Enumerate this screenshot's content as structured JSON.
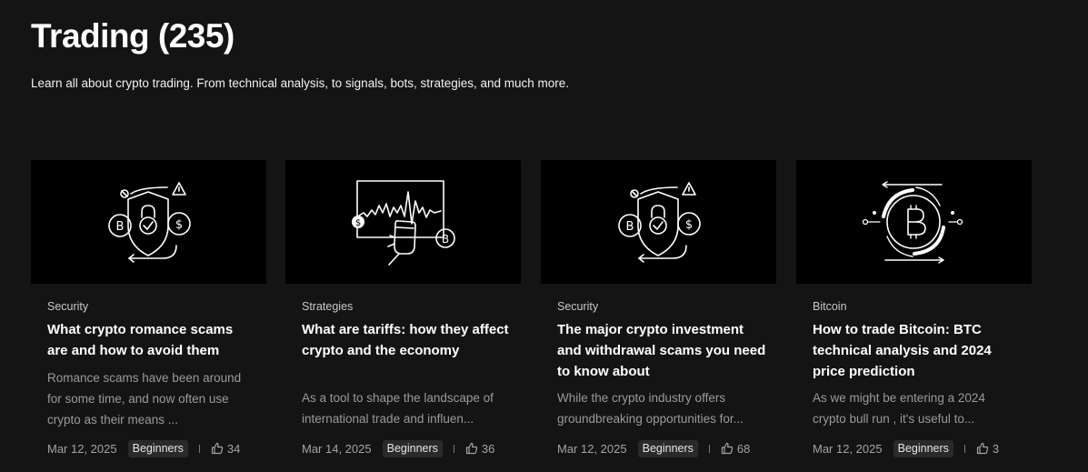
{
  "header": {
    "title": "Trading (235)",
    "subtitle": "Learn all about crypto trading. From technical analysis, to signals, bots, strategies, and much more."
  },
  "cards": [
    {
      "category": "Security",
      "title": "What crypto romance scams are and how to avoid them",
      "excerpt": "Romance scams have been around for some time, and now often use crypto as their means ...",
      "date": "Mar 12, 2025",
      "tag": "Beginners",
      "likes": "34",
      "image_icon": "shield-scam-icon"
    },
    {
      "category": "Strategies",
      "title": "What are tariffs: how they affect crypto and the economy",
      "excerpt": "As a tool to shape the landscape of international trade and influen...",
      "date": "Mar 14, 2025",
      "tag": "Beginners",
      "likes": "36",
      "image_icon": "price-chart-icon"
    },
    {
      "category": "Security",
      "title": "The major crypto investment and withdrawal scams you need to know about",
      "excerpt": "While the crypto industry offers groundbreaking opportunities for...",
      "date": "Mar 12, 2025",
      "tag": "Beginners",
      "likes": "68",
      "image_icon": "shield-scam-icon"
    },
    {
      "category": "Bitcoin",
      "title": "How to trade Bitcoin: BTC technical analysis and 2024 price prediction",
      "excerpt": "As we might be entering a 2024 crypto bull run , it's useful to...",
      "date": "Mar 12, 2025",
      "tag": "Beginners",
      "likes": "3",
      "image_icon": "bitcoin-cycle-icon"
    }
  ],
  "colors": {
    "background": "#141414",
    "card_image_bg": "#000000",
    "text_primary": "#ffffff",
    "text_muted": "#9a9a9a",
    "tag_bg": "#2a2a2a"
  }
}
